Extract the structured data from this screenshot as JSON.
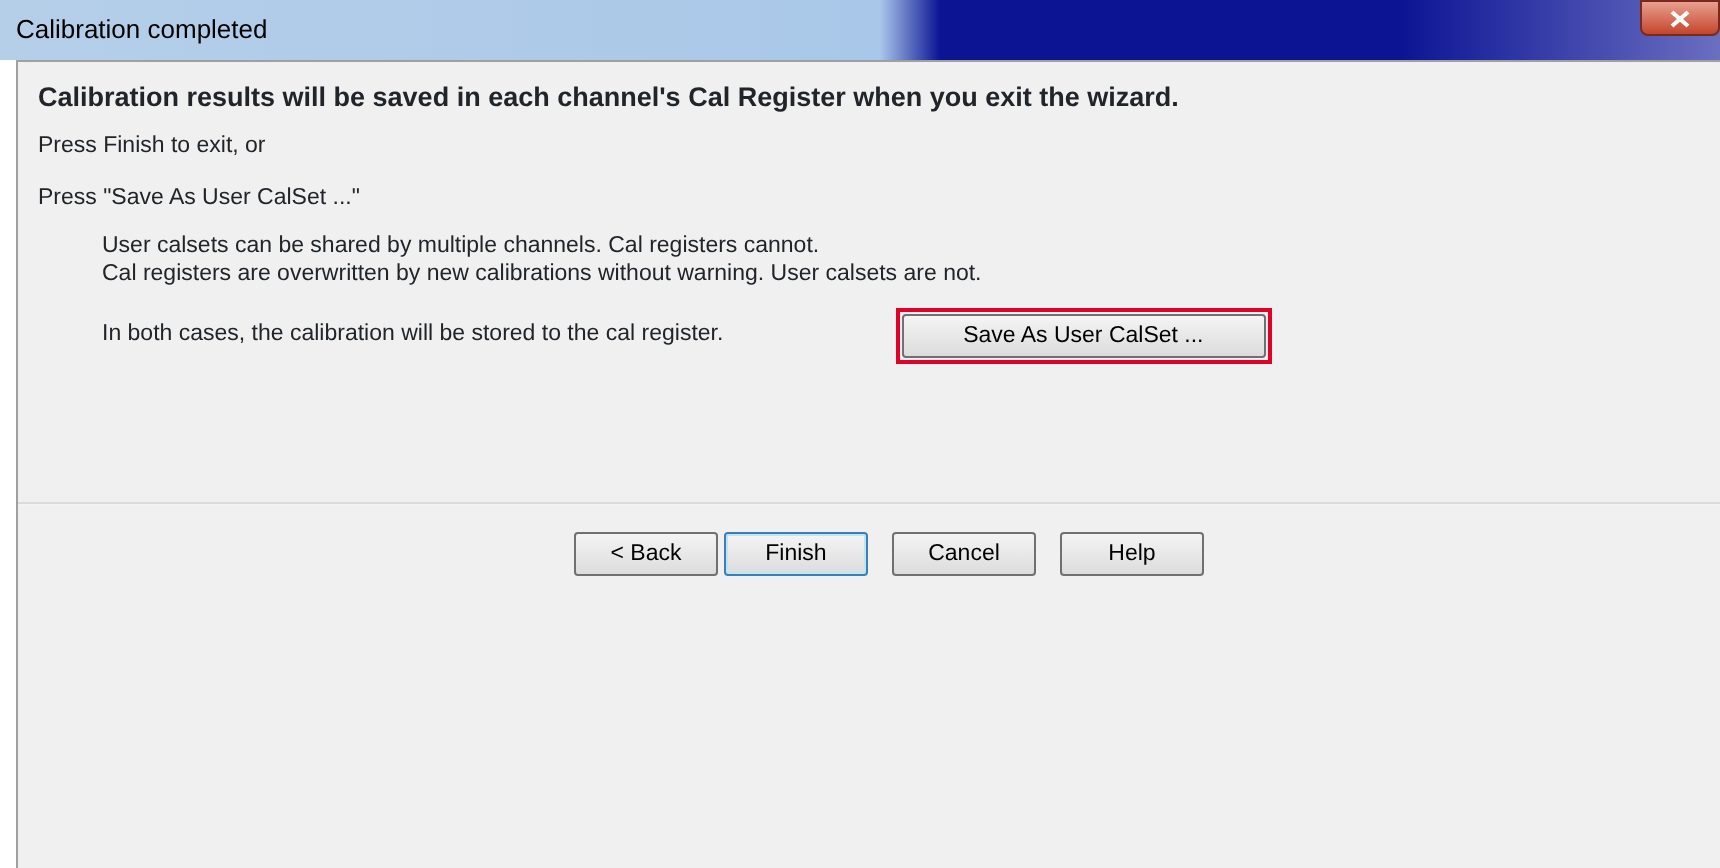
{
  "window": {
    "title": "Calibration completed"
  },
  "heading": "Calibration results will be saved in each channel's Cal Register when you exit the wizard.",
  "lines": [
    "Press Finish to exit, or",
    "Press \"Save As User CalSet ...\""
  ],
  "notes": [
    "User calsets can be shared by multiple channels. Cal registers cannot.",
    "Cal registers are overwritten by new calibrations without warning. User calsets are not."
  ],
  "info": "In both cases, the calibration will be stored to the cal register.",
  "save_button": {
    "label": "Save As User CalSet ...",
    "highlighted": true
  },
  "buttons": [
    {
      "label": "< Back",
      "default": false
    },
    {
      "label": "Finish",
      "default": true
    },
    {
      "label": "Cancel",
      "default": false
    },
    {
      "label": "Help",
      "default": false
    }
  ]
}
